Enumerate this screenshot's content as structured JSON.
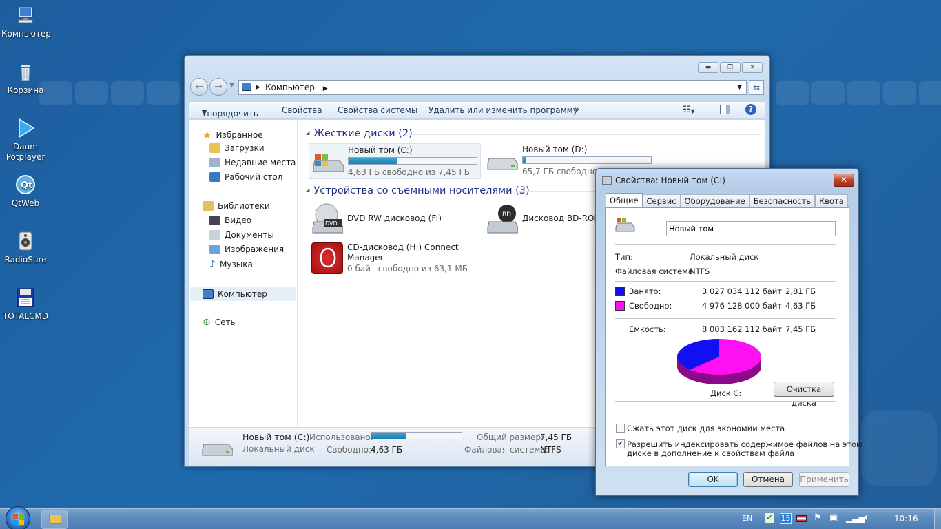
{
  "desktop": {
    "icons": [
      {
        "label": "Компьютер",
        "icon": "computer-icon"
      },
      {
        "label": "Корзина",
        "icon": "recycle-bin-icon"
      },
      {
        "label": "Daum Potplayer",
        "icon": "potplayer-icon"
      },
      {
        "label": "QtWeb",
        "icon": "qtweb-icon"
      },
      {
        "label": "RadioSure",
        "icon": "radio-icon"
      },
      {
        "label": "TOTALCMD",
        "icon": "floppy-icon"
      }
    ]
  },
  "explorer": {
    "address": "Компьютер",
    "toolbar": {
      "organize": "Упорядочить",
      "properties": "Свойства",
      "system_properties": "Свойства системы",
      "uninstall": "Удалить или изменить программу",
      "more": "»"
    },
    "nav": {
      "favorites": "Избранное",
      "downloads": "Загрузки",
      "recent": "Недавние места",
      "desktop": "Рабочий стол",
      "libraries": "Библиотеки",
      "video": "Видео",
      "documents": "Документы",
      "images": "Изображения",
      "music": "Музыка",
      "computer": "Компьютер",
      "network": "Сеть"
    },
    "sections": {
      "hard_drives": "Жесткие диски (2)",
      "removable": "Устройства со съемными носителями (3)"
    },
    "drives": [
      {
        "name": "Новый том (C:)",
        "free_text": "4,63 ГБ свободно из 7,45 ГБ",
        "used_fraction": 0.38
      },
      {
        "name": "Новый том (D:)",
        "free_text": "65,7 ГБ свободно из",
        "used_fraction": 0.02
      },
      {
        "name": "DVD RW дисковод (F:)"
      },
      {
        "name": "Дисковод BD-ROM"
      },
      {
        "name": "CD-дисковод (H:) Connect Manager",
        "free_text": "0 байт свободно из 63,1 МБ"
      }
    ],
    "details": {
      "name": "Новый том (C:)",
      "type": "Локальный диск",
      "used_label": "Использовано:",
      "free_label": "Свободно:",
      "free_value": "4,63 ГБ",
      "total_label": "Общий размер:",
      "total_value": "7,45 ГБ",
      "fs_label": "Файловая система:",
      "fs_value": "NTFS",
      "used_fraction": 0.38
    }
  },
  "dialog": {
    "title": "Свойства: Новый том (C:)",
    "tabs": [
      "Общие",
      "Сервис",
      "Оборудование",
      "Безопасность",
      "Квота"
    ],
    "volume_name": "Новый том",
    "type_label": "Тип:",
    "type_value": "Локальный диск",
    "fs_label": "Файловая система:",
    "fs_value": "NTFS",
    "used_label": "Занято:",
    "used_bytes": "3 027 034 112 байт",
    "used_gb": "2,81 ГБ",
    "free_label": "Свободно:",
    "free_bytes": "4 976 128 000 байт",
    "free_gb": "4,63 ГБ",
    "capacity_label": "Емкость:",
    "capacity_bytes": "8 003 162 112 байт",
    "capacity_gb": "7,45 ГБ",
    "disk_label": "Диск C:",
    "cleanup_button": "Очистка диска",
    "compress_label": "Сжать этот диск для экономии места",
    "compress_checked": false,
    "index_label_1": "Разрешить индексировать содержимое файлов на этом",
    "index_label_2": "диске в дополнение к свойствам файла",
    "index_checked": true,
    "ok": "OK",
    "cancel": "Отмена",
    "apply": "Применить",
    "colors": {
      "used": "#1010f0",
      "free": "#ff10f0"
    },
    "pie": {
      "used_fraction": 0.378
    }
  },
  "taskbar": {
    "lang": "EN",
    "badge": "15",
    "time": "10:16"
  }
}
